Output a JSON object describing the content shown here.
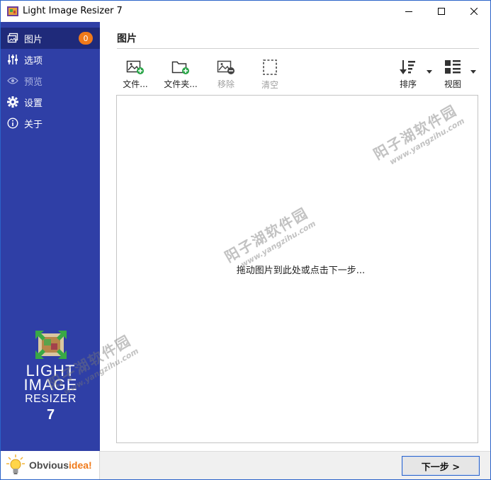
{
  "window": {
    "title": "Light Image Resizer 7",
    "accent": "#2f3fa6"
  },
  "sidebar": {
    "items": [
      {
        "id": "images",
        "label": "图片",
        "icon": "images-icon",
        "badge": "0",
        "active": true
      },
      {
        "id": "options",
        "label": "选项",
        "icon": "sliders-icon"
      },
      {
        "id": "preview",
        "label": "预览",
        "icon": "eye-icon",
        "disabled": true
      },
      {
        "id": "settings",
        "label": "设置",
        "icon": "gear-icon"
      },
      {
        "id": "about",
        "label": "关于",
        "icon": "info-icon"
      }
    ],
    "logo": {
      "line1": "LIGHT",
      "line2": "IMAGE",
      "line3": "RESIZER",
      "line4": "7"
    },
    "brand": {
      "name_part1": "Obvious",
      "name_part2": "idea!"
    }
  },
  "main": {
    "title": "图片",
    "toolbar": {
      "add_file": "文件...",
      "add_folder": "文件夹...",
      "remove": "移除",
      "clear": "清空",
      "sort": "排序",
      "view": "视图"
    },
    "drop_hint": "拖动图片到此处或点击下一步..."
  },
  "footer": {
    "next_label": "下一步 >"
  },
  "watermark": {
    "cn": "阳子湖软件园",
    "url": "www.yangzihu.com"
  }
}
